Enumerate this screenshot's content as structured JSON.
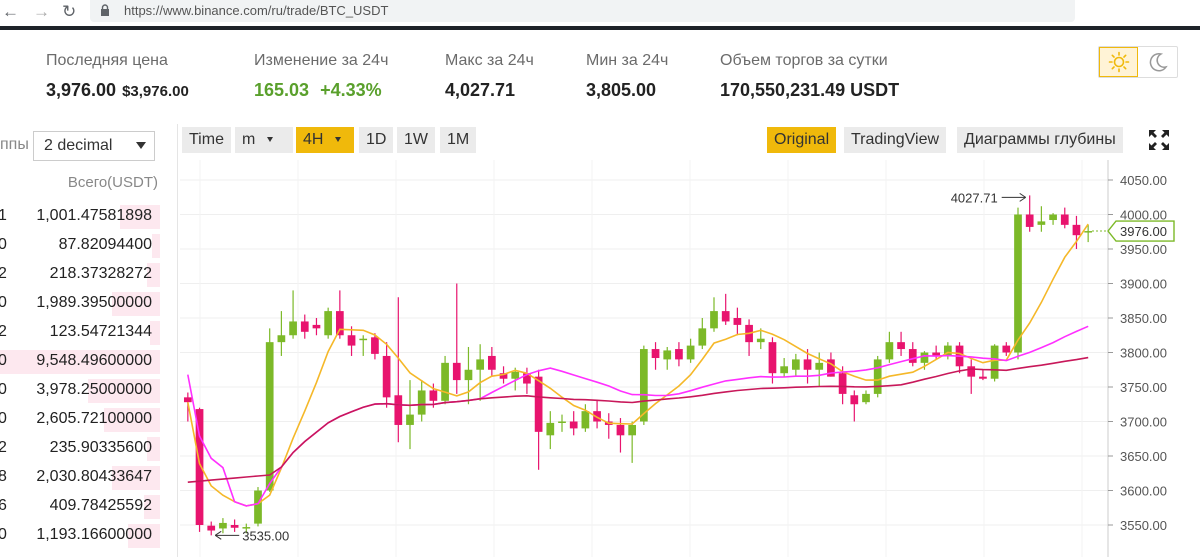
{
  "browser": {
    "back_icon": "back-arrow-icon",
    "forward_icon": "forward-arrow-icon",
    "reload_icon": "reload-icon",
    "url": "https://www.binance.com/ru/trade/BTC_USDT"
  },
  "stats": {
    "last_price_label": "Последняя цена",
    "last_price": "3,976.00",
    "last_price_usd": "$3,976.00",
    "change_label": "Изменение за 24ч",
    "change_value": "165.03",
    "change_percent": "+4.33%",
    "high_label": "Макс за 24ч",
    "high_value": "4,027.71",
    "low_label": "Мин за 24ч",
    "low_value": "3,805.00",
    "volume_label": "Объем торгов за сутки",
    "volume_value": "170,550,231.49 USDT"
  },
  "theme": {
    "light_icon": "sun-icon",
    "dark_icon": "moon-icon"
  },
  "orderbook": {
    "group_label": "ппы",
    "decimal_select": "2 decimal",
    "total_header": "Всего(USDT)",
    "rows": [
      {
        "lead": "1",
        "total": "1,001.47581898",
        "depth": 0.25
      },
      {
        "lead": "0",
        "total": "87.82094400",
        "depth": 0.05
      },
      {
        "lead": "2",
        "total": "218.37328272",
        "depth": 0.08
      },
      {
        "lead": "0",
        "total": "1,989.39500000",
        "depth": 0.3
      },
      {
        "lead": "2",
        "total": "123.54721344",
        "depth": 0.06
      },
      {
        "lead": "0",
        "total": "9,548.49600000",
        "depth": 1.0
      },
      {
        "lead": "0",
        "total": "3,978.25000000",
        "depth": 0.45
      },
      {
        "lead": "0",
        "total": "2,605.72100000",
        "depth": 0.35
      },
      {
        "lead": "2",
        "total": "235.90335600",
        "depth": 0.08
      },
      {
        "lead": "8",
        "total": "2,030.80433647",
        "depth": 0.3
      },
      {
        "lead": "6",
        "total": "409.78425592",
        "depth": 0.1
      },
      {
        "lead": "0",
        "total": "1,193.16600000",
        "depth": 0.2
      }
    ]
  },
  "toolbar": {
    "time": "Time",
    "minute": "m",
    "interval": "4H",
    "day": "1D",
    "week": "1W",
    "month": "1M",
    "original": "Original",
    "tradingview": "TradingView",
    "depth": "Диаграммы глубины",
    "expand_icon": "fullscreen-icon"
  },
  "chart_data": {
    "type": "candlestick",
    "ylim": [
      3520,
      4070
    ],
    "y_ticks": [
      "4050.00",
      "4000.00",
      "3950.00",
      "3900.00",
      "3850.00",
      "3800.00",
      "3750.00",
      "3700.00",
      "3650.00",
      "3600.00",
      "3550.00"
    ],
    "y_tick_values": [
      4050,
      4000,
      3950,
      3900,
      3850,
      3800,
      3750,
      3700,
      3650,
      3600,
      3550
    ],
    "current_price": "3976.00",
    "current_value": 3976,
    "high_marker": "4027.71",
    "high_value": 4027.71,
    "low_marker": "3535.00",
    "low_value": 3535,
    "colors": {
      "up": "#7cb928",
      "down": "#e8146e",
      "ma_yellow": "#f5b829",
      "ma_magenta": "#ff30ff",
      "ma_crimson": "#c8185a"
    },
    "candles": [
      [
        3735,
        3742,
        3700,
        3728
      ],
      [
        3718,
        3720,
        3540,
        3550
      ],
      [
        3549,
        3555,
        3535,
        3542
      ],
      [
        3545,
        3560,
        3538,
        3553
      ],
      [
        3550,
        3558,
        3540,
        3546
      ],
      [
        3545,
        3552,
        3538,
        3547
      ],
      [
        3552,
        3605,
        3548,
        3600
      ],
      [
        3600,
        3835,
        3598,
        3815
      ],
      [
        3815,
        3860,
        3795,
        3825
      ],
      [
        3825,
        3890,
        3820,
        3845
      ],
      [
        3845,
        3855,
        3820,
        3830
      ],
      [
        3840,
        3850,
        3825,
        3835
      ],
      [
        3825,
        3865,
        3820,
        3860
      ],
      [
        3860,
        3890,
        3820,
        3825
      ],
      [
        3825,
        3838,
        3795,
        3810
      ],
      [
        3818,
        3825,
        3795,
        3820
      ],
      [
        3822,
        3828,
        3790,
        3798
      ],
      [
        3795,
        3815,
        3720,
        3735
      ],
      [
        3738,
        3880,
        3670,
        3695
      ],
      [
        3695,
        3760,
        3660,
        3710
      ],
      [
        3710,
        3760,
        3700,
        3745
      ],
      [
        3745,
        3755,
        3720,
        3730
      ],
      [
        3730,
        3795,
        3725,
        3785
      ],
      [
        3785,
        3900,
        3740,
        3760
      ],
      [
        3760,
        3808,
        3725,
        3775
      ],
      [
        3775,
        3812,
        3730,
        3790
      ],
      [
        3795,
        3808,
        3765,
        3775
      ],
      [
        3770,
        3780,
        3755,
        3762
      ],
      [
        3762,
        3778,
        3745,
        3772
      ],
      [
        3770,
        3778,
        3740,
        3755
      ],
      [
        3765,
        3775,
        3630,
        3685
      ],
      [
        3680,
        3715,
        3660,
        3698
      ],
      [
        3698,
        3710,
        3685,
        3700
      ],
      [
        3700,
        3715,
        3680,
        3690
      ],
      [
        3690,
        3725,
        3685,
        3715
      ],
      [
        3715,
        3730,
        3690,
        3700
      ],
      [
        3700,
        3712,
        3675,
        3695
      ],
      [
        3695,
        3705,
        3655,
        3680
      ],
      [
        3680,
        3700,
        3640,
        3695
      ],
      [
        3700,
        3810,
        3695,
        3805
      ],
      [
        3805,
        3815,
        3775,
        3792
      ],
      [
        3790,
        3808,
        3775,
        3803
      ],
      [
        3805,
        3815,
        3780,
        3790
      ],
      [
        3790,
        3820,
        3785,
        3810
      ],
      [
        3810,
        3850,
        3805,
        3835
      ],
      [
        3835,
        3880,
        3830,
        3860
      ],
      [
        3860,
        3885,
        3840,
        3845
      ],
      [
        3850,
        3865,
        3825,
        3840
      ],
      [
        3840,
        3848,
        3795,
        3815
      ],
      [
        3815,
        3835,
        3805,
        3820
      ],
      [
        3815,
        3822,
        3755,
        3770
      ],
      [
        3770,
        3792,
        3765,
        3780
      ],
      [
        3775,
        3798,
        3765,
        3790
      ],
      [
        3790,
        3805,
        3755,
        3775
      ],
      [
        3775,
        3800,
        3750,
        3785
      ],
      [
        3790,
        3800,
        3765,
        3765
      ],
      [
        3770,
        3780,
        3725,
        3740
      ],
      [
        3738,
        3745,
        3700,
        3725
      ],
      [
        3728,
        3745,
        3725,
        3740
      ],
      [
        3740,
        3795,
        3735,
        3790
      ],
      [
        3790,
        3830,
        3785,
        3815
      ],
      [
        3815,
        3830,
        3795,
        3805
      ],
      [
        3805,
        3815,
        3780,
        3785
      ],
      [
        3785,
        3802,
        3775,
        3800
      ],
      [
        3800,
        3810,
        3790,
        3795
      ],
      [
        3795,
        3815,
        3790,
        3810
      ],
      [
        3810,
        3815,
        3770,
        3780
      ],
      [
        3780,
        3790,
        3740,
        3765
      ],
      [
        3765,
        3775,
        3760,
        3762
      ],
      [
        3762,
        3812,
        3758,
        3810
      ],
      [
        3810,
        3815,
        3795,
        3800
      ],
      [
        3800,
        4010,
        3790,
        4000
      ],
      [
        4000,
        4027.71,
        3975,
        3982
      ],
      [
        3985,
        4012,
        3975,
        3990
      ],
      [
        3992,
        4002,
        3985,
        4000
      ],
      [
        4000,
        4010,
        3980,
        3985
      ],
      [
        3985,
        3998,
        3950,
        3970
      ],
      [
        3975,
        3985,
        3960,
        3976
      ]
    ]
  }
}
